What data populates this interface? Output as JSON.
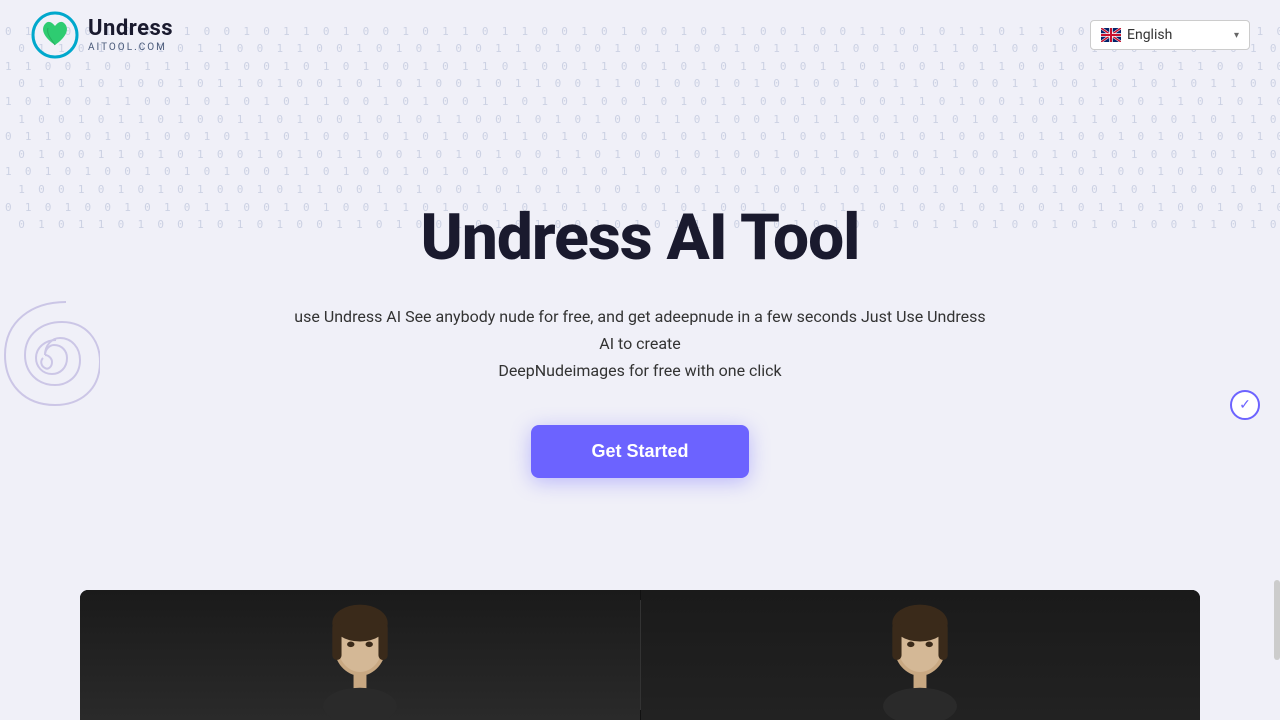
{
  "header": {
    "logo": {
      "main_text": "Undress",
      "sub_text": "AITOOL.COM"
    },
    "language_selector": {
      "label": "English",
      "flag": "en"
    }
  },
  "hero": {
    "title": "Undress AI Tool",
    "description_line1": "use Undress AI See anybody nude for free, and get adeepnude in a few seconds Just Use Undress AI to create",
    "description_line2": "DeepNudeimages for free with one click",
    "cta_button": "Get Started"
  },
  "binary_content": "0 1 0 0 1 0 1 1 0 1 1 0\n1 0 0 1 0 1 1 0 0 1 0 1\n0 1 1 0 1 0 0 1 0 1 1 0\n1 0 0 1 1 0 1 0 1 0 0 1\n0 1 0 1 0 1 0 0 1 1 0 1\n1 0 1 0 1 0 1 1 0 0 1 0",
  "icons": {
    "chevron_down": "▾",
    "checkmark": "✓"
  }
}
